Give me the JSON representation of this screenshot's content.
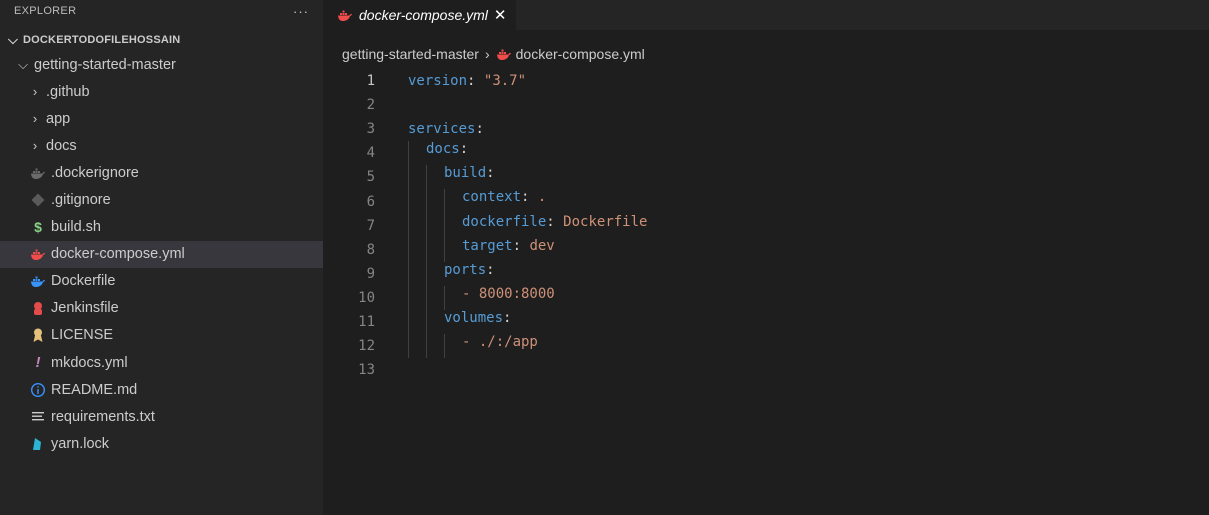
{
  "explorer": {
    "title": "EXPLORER",
    "more_label": "···",
    "workspace": "DOCKERTODOFILEHOSSAIN",
    "root_folder": "getting-started-master",
    "folders": [
      ".github",
      "app",
      "docs"
    ],
    "files": [
      {
        "name": ".dockerignore",
        "icon": "docker-ignore-icon",
        "color": "#6b6b6b"
      },
      {
        "name": ".gitignore",
        "icon": "git-icon",
        "color": "#5a5a5a"
      },
      {
        "name": "build.sh",
        "icon": "shell-icon",
        "color": "#89d185"
      },
      {
        "name": "docker-compose.yml",
        "icon": "docker-compose-icon",
        "color": "#f14c4c",
        "selected": true
      },
      {
        "name": "Dockerfile",
        "icon": "docker-icon",
        "color": "#3794ff"
      },
      {
        "name": "Jenkinsfile",
        "icon": "jenkins-icon",
        "color": "#e44c4c"
      },
      {
        "name": "LICENSE",
        "icon": "license-icon",
        "color": "#e5c07b"
      },
      {
        "name": "mkdocs.yml",
        "icon": "yaml-icon",
        "color": "#c586c0"
      },
      {
        "name": "README.md",
        "icon": "info-icon",
        "color": "#3794ff"
      },
      {
        "name": "requirements.txt",
        "icon": "text-lines-icon",
        "color": "#cccccc"
      },
      {
        "name": "yarn.lock",
        "icon": "yarn-icon",
        "color": "#2bb5d4"
      }
    ]
  },
  "tab": {
    "label": "docker-compose.yml",
    "close_label": "✕"
  },
  "breadcrumb": {
    "folder": "getting-started-master",
    "separator": "›",
    "file": "docker-compose.yml"
  },
  "colors": {
    "keyword": "#569cd6",
    "string": "#ce9178",
    "accent_docker_compose": "#f14c4c"
  },
  "code_lines": [
    {
      "n": "1",
      "indent": 0,
      "key": "version",
      "value": "\"3.7\""
    },
    {
      "n": "2",
      "indent": 0,
      "key": "",
      "value": ""
    },
    {
      "n": "3",
      "indent": 0,
      "key": "services",
      "value": ""
    },
    {
      "n": "4",
      "indent": 1,
      "key": "docs",
      "value": ""
    },
    {
      "n": "5",
      "indent": 2,
      "key": "build",
      "value": ""
    },
    {
      "n": "6",
      "indent": 3,
      "key": "context",
      "value": "."
    },
    {
      "n": "7",
      "indent": 3,
      "key": "dockerfile",
      "value": "Dockerfile"
    },
    {
      "n": "8",
      "indent": 3,
      "key": "target",
      "value": "dev"
    },
    {
      "n": "9",
      "indent": 2,
      "key": "ports",
      "value": ""
    },
    {
      "n": "10",
      "indent": 3,
      "key": "",
      "value": "- 8000:8000"
    },
    {
      "n": "11",
      "indent": 2,
      "key": "volumes",
      "value": ""
    },
    {
      "n": "12",
      "indent": 3,
      "key": "",
      "value": "- ./:/app"
    },
    {
      "n": "13",
      "indent": 0,
      "key": "",
      "value": ""
    }
  ]
}
